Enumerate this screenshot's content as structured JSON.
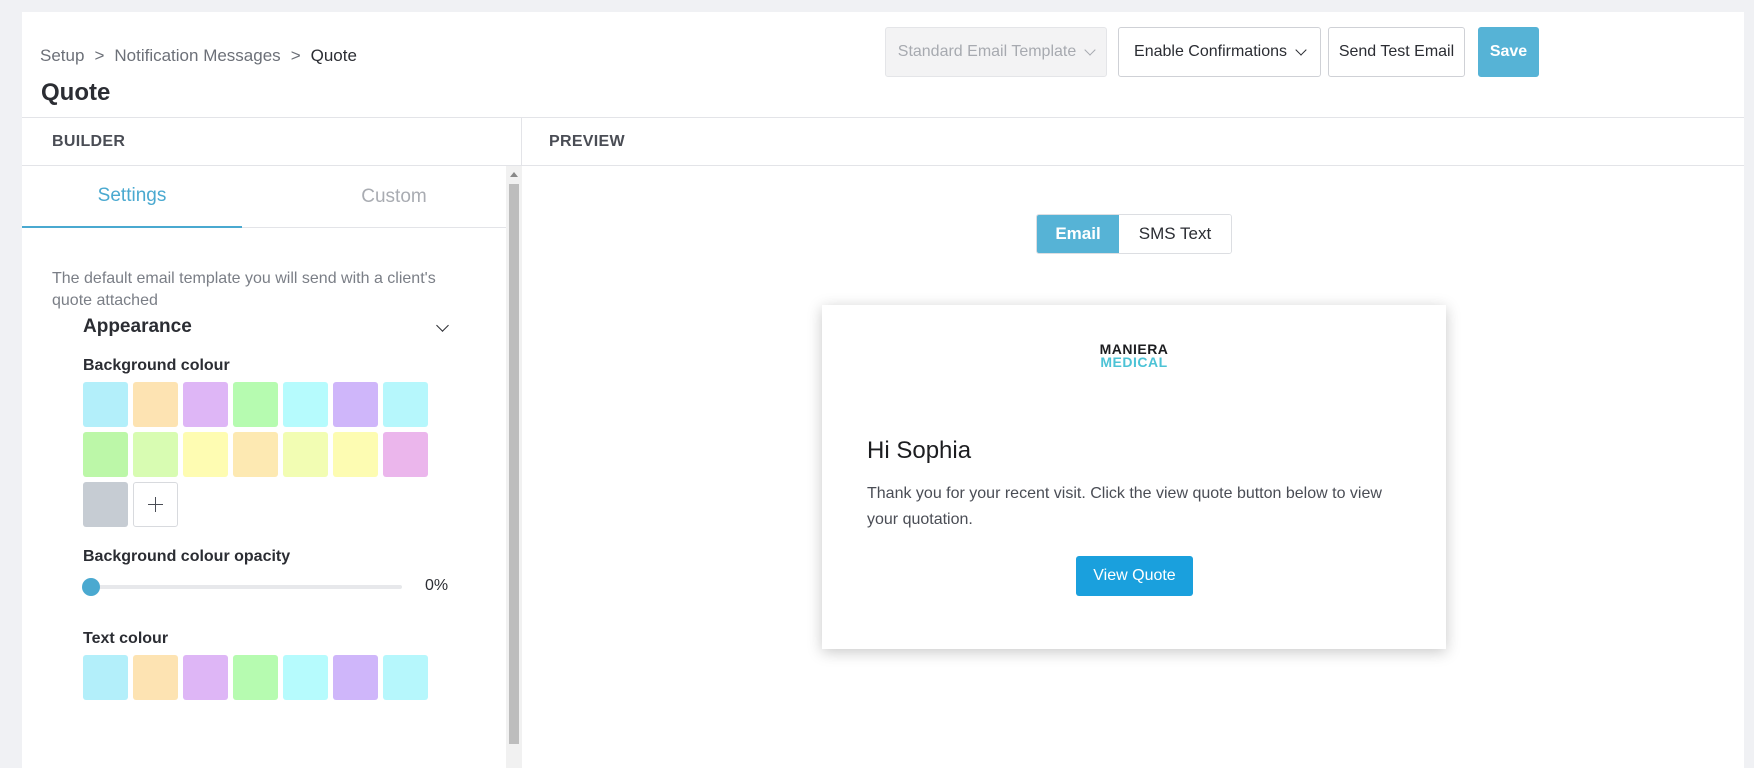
{
  "breadcrumb": {
    "items": [
      "Setup",
      "Notification Messages",
      "Quote"
    ],
    "separator": ">"
  },
  "page_title": "Quote",
  "header_actions": {
    "template_select": "Standard Email Template",
    "confirmations_select": "Enable Confirmations",
    "send_test": "Send Test Email",
    "save": "Save"
  },
  "builder": {
    "heading": "BUILDER",
    "tabs": {
      "settings": "Settings",
      "custom": "Custom"
    },
    "description": "The default email template you will send with a client's quote attached",
    "appearance": "Appearance",
    "background_colour_label": "Background colour",
    "background_colours": [
      "#b3effa",
      "#fde3b2",
      "#deb6f6",
      "#b6fbb0",
      "#b6fbfd",
      "#cfb6fa",
      "#b6f7fc",
      "#bcf7a8",
      "#d8fcb2",
      "#fefcb2",
      "#fde9b2",
      "#f2fdb3",
      "#fdfcb2",
      "#ebb6ec",
      "#c6ccd3"
    ],
    "opacity_label": "Background colour opacity",
    "opacity_value": "0%",
    "opacity_fraction": 0,
    "text_colour_label": "Text colour",
    "text_colours": [
      "#b3effa",
      "#fde3b2",
      "#deb6f6",
      "#b6fbb0",
      "#b6fbfd",
      "#cfb6fa",
      "#b6f7fc"
    ]
  },
  "preview": {
    "heading": "PREVIEW",
    "mode_tabs": {
      "email": "Email",
      "sms": "SMS Text"
    },
    "email": {
      "logo_line1": "MANIERA",
      "logo_line2": "MEDICAL",
      "greeting": "Hi Sophia",
      "body": "Thank you for your recent visit. Click the view quote button below to view your quotation.",
      "button": "View Quote"
    }
  },
  "colors": {
    "accent": "#56b3d6",
    "quote_button": "#1aa0dd",
    "logo_accent": "#4cc3d6"
  },
  "icons": {
    "add_colour": "plus-icon",
    "dropdown": "chevron-down-icon"
  }
}
